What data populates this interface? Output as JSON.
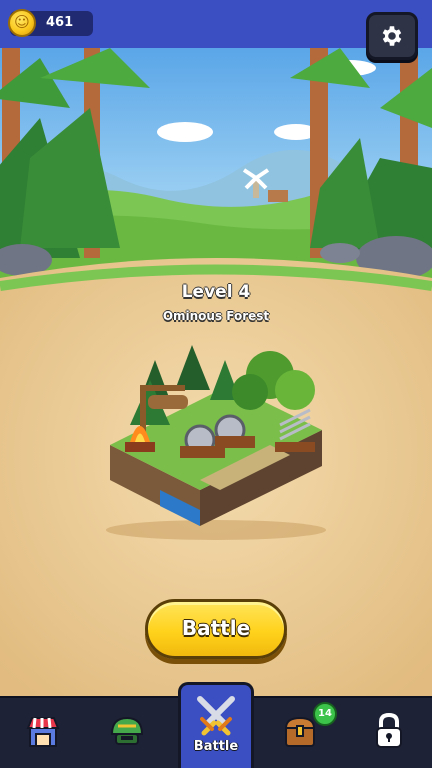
{
  "currency": {
    "icon": "coin-icon",
    "value": "461"
  },
  "settings": {
    "icon": "gear-icon"
  },
  "level": {
    "title": "Level 4",
    "subtitle": "Ominous Forest"
  },
  "battle_button": {
    "label": "Battle"
  },
  "nav": {
    "items": [
      {
        "id": "shop",
        "icon": "shop-icon"
      },
      {
        "id": "heroes",
        "icon": "helmet-icon"
      },
      {
        "id": "battle",
        "icon": "crossed-swords-icon",
        "label": "Battle",
        "active": true
      },
      {
        "id": "chest",
        "icon": "chest-icon",
        "badge": "14"
      },
      {
        "id": "locked",
        "icon": "lock-icon"
      }
    ]
  },
  "colors": {
    "topbar": "#3b4ec2",
    "nav": "#1e2236",
    "button": "#ffd21c",
    "badge": "#3cc44a"
  }
}
